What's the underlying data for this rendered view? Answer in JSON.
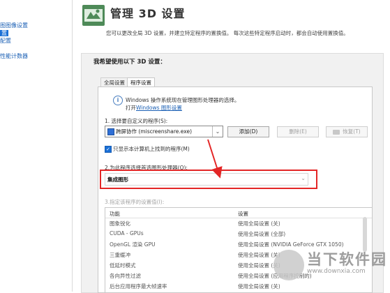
{
  "sidebar": {
    "items": [
      {
        "label": "图图像设置"
      },
      {
        "label": "置",
        "selected": true
      },
      {
        "label": "配置"
      },
      {
        "label": "性能计数器"
      }
    ]
  },
  "header": {
    "title": "管理 3D 设置",
    "description": "您可以更改全局 3D 设置，并建立特定程序的置换值。 每次这些特定程序启动时，都会自动使用置换值。"
  },
  "panel": {
    "title": "我希望使用以下 3D 设置："
  },
  "tabs": [
    {
      "label": "全局设置"
    },
    {
      "label": "程序设置",
      "active": true
    }
  ],
  "info": {
    "line1": "Windows 操作系统现在管理图形处理器的选择。",
    "open_prefix": "打开",
    "link_text": "Windows 图形设置"
  },
  "step1": {
    "label": "1. 选择要自定义的程序(S):",
    "program_value": "跨屏协作 (miscreenshare.exe)",
    "add_button": "添加(D)",
    "delete_button": "删除(E)",
    "restore_button": "恢复(T)"
  },
  "checkbox": {
    "label": "只显示本计算机上找到的程序(M)",
    "checked": true
  },
  "step2": {
    "label": "2.为此程序选择首选图形处理器(O):",
    "value": "集成图形"
  },
  "step3": {
    "label": "3.指定该程序的设置值(I):"
  },
  "table": {
    "headers": [
      "功能",
      "设置"
    ],
    "rows": [
      [
        "图象锐化",
        "使用全局设置 (关)"
      ],
      [
        "CUDA - GPUs",
        "使用全局设置 (全部)"
      ],
      [
        "OpenGL 渲染 GPU",
        "使用全局设置 (NVIDIA GeForce GTX 1050)"
      ],
      [
        "三重缓冲",
        "使用全局设置 (关)"
      ],
      [
        "低延时模式",
        "使用全局设置 (关)"
      ],
      [
        "各向异性过滤",
        "使用全局设置 (应用程序控制的)"
      ],
      [
        "后台应用程序最大帧速率",
        "使用全局设置 (关)"
      ]
    ]
  },
  "watermark": {
    "text": "当下软件园",
    "url": "www.downxia.com"
  },
  "colors": {
    "link": "#1a5fb4",
    "highlight_border": "#e32626",
    "arrow": "#e32626"
  }
}
